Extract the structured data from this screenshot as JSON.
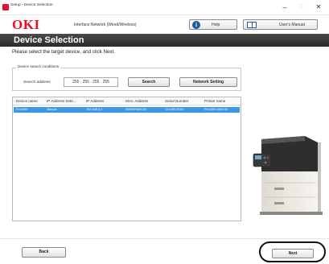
{
  "window": {
    "title": "Setup - Device Selection",
    "minimize_glyph": "–",
    "maximize_glyph": "□",
    "close_glyph": "✕"
  },
  "header": {
    "logo": "OKI",
    "interface": "Interface:Network (Wired/Wireless)",
    "help_label": "Help",
    "help_icon": "i",
    "manual_label": "User's Manual"
  },
  "banner": {
    "title": "Device Selection"
  },
  "instruction": "Please select the target device, and click Next.",
  "search_conditions": {
    "legend": "Device search conditions",
    "address_label": "Search address",
    "address_value": "255 . 255 . 255 . 255",
    "search_label": "Search",
    "network_setting_label": "Network Setting"
  },
  "device_table": {
    "columns": [
      "Device name",
      "IP Address Setti...",
      "IP Address",
      "MAC Address",
      "Serial Number",
      "Printer name"
    ],
    "rows": [
      [
        "Pro1050",
        "Manual",
        "192.168.0.2",
        "0080875A5C90",
        "121A5075000",
        "Pro1050-5A5C90"
      ]
    ]
  },
  "footer": {
    "back_label": "Back",
    "next_label": "Next"
  },
  "colors": {
    "brand": "#e8102a",
    "banner": "#333333",
    "selection": "#3c97e6",
    "highlight_ring": "#111111"
  }
}
